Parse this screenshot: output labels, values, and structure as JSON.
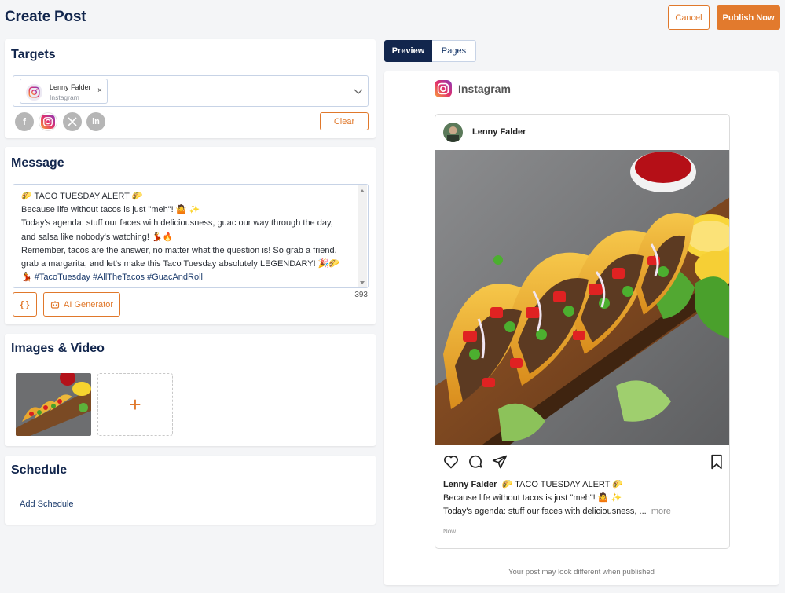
{
  "header": {
    "title": "Create Post",
    "cancel_label": "Cancel",
    "publish_label": "Publish Now"
  },
  "targets": {
    "title": "Targets",
    "selected": {
      "name": "Lenny Falder",
      "network": "Instagram",
      "remove": "×"
    },
    "networks": [
      "facebook",
      "instagram",
      "x",
      "linkedin"
    ],
    "clear_label": "Clear"
  },
  "message": {
    "title": "Message",
    "lines": [
      "🌮 TACO TUESDAY ALERT 🌮",
      "Because life without tacos is just \"meh\"! 🤷 ✨",
      "Today's agenda: stuff our faces with deliciousness, guac our way through the day,",
      "and salsa like nobody's watching! 💃🔥",
      "Remember, tacos are the answer, no matter what the question is! So grab a friend,",
      "grab a margarita, and let's make this Taco Tuesday absolutely LEGENDARY! 🎉🌮",
      "💃 #TacoTuesday #AllTheTacos #GuacAndRoll"
    ],
    "char_count": "393",
    "variables_label": "{ }",
    "ai_label": "AI Generator"
  },
  "images": {
    "title": "Images & Video",
    "add_label": "+"
  },
  "schedule": {
    "title": "Schedule",
    "add_label": "Add Schedule"
  },
  "preview": {
    "tabs": [
      {
        "label": "Preview",
        "active": true
      },
      {
        "label": "Pages",
        "active": false
      }
    ],
    "network_label": "Instagram",
    "post_user": "Lenny Falder",
    "caption_user": "Lenny Falder",
    "caption_line1": "🌮 TACO TUESDAY ALERT 🌮",
    "caption_line2": "Because life without tacos is just \"meh\"! 🤷 ✨",
    "caption_line3": "Today's agenda: stuff our faces with deliciousness, ...",
    "more_label": "more",
    "time": "Now",
    "disclaimer": "Your post may look different when published"
  },
  "colors": {
    "accent": "#e27a2d",
    "navy": "#12264d",
    "border": "#c7d3e6"
  }
}
